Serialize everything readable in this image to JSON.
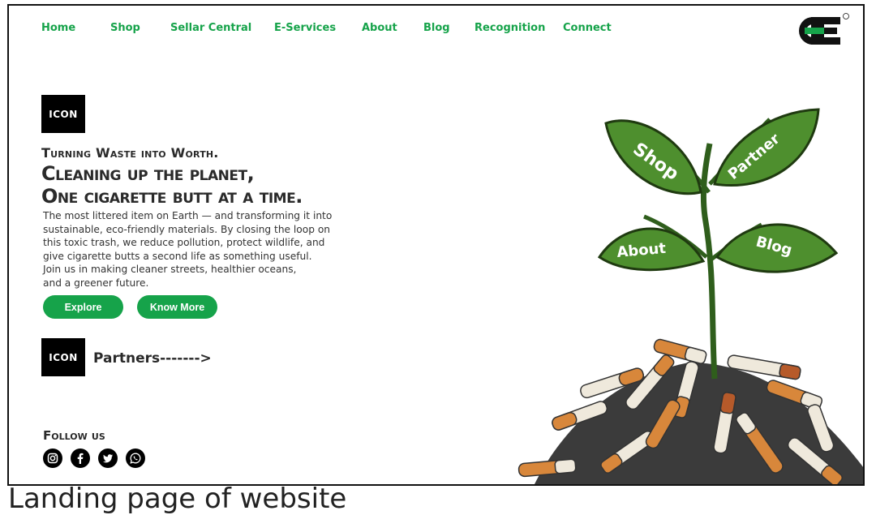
{
  "nav": {
    "items": [
      {
        "label": "Home"
      },
      {
        "label": "Shop"
      },
      {
        "label": "Sellar Central"
      },
      {
        "label": "E-Services"
      },
      {
        "label": "About"
      },
      {
        "label": "Blog"
      },
      {
        "label": "Recognition"
      },
      {
        "label": "Connect"
      }
    ]
  },
  "brand": {
    "logo_text": "CE",
    "trademark": "TM",
    "color": "#111111"
  },
  "hero": {
    "icon_label": "ICON",
    "tagline": "Turning Waste into Worth.",
    "headline_line1": "Cleaning up the planet,",
    "headline_line2": "One cigarette butt at a time.",
    "description": [
      "The most littered item on Earth — and transforming it into",
      "sustainable, eco-friendly materials. By closing the loop on",
      "this toxic trash, we reduce pollution, protect wildlife, and",
      "give cigarette butts a second life as something useful.",
      "Join us in making cleaner streets, healthier oceans,",
      "and a greener future."
    ],
    "explore_label": "Explore",
    "know_more_label": "Know More",
    "accent": "#16a34a"
  },
  "partners": {
    "icon_label": "ICON",
    "label": "Partners------->"
  },
  "follow": {
    "label": "Follow us",
    "icons": [
      "instagram-icon",
      "facebook-icon",
      "twitter-icon",
      "whatsapp-icon"
    ]
  },
  "illustration": {
    "leaves": [
      "Shop",
      "Partner",
      "About",
      "Blog"
    ],
    "leaf_color": "#4e8f2e"
  },
  "caption": "Landing page of website"
}
